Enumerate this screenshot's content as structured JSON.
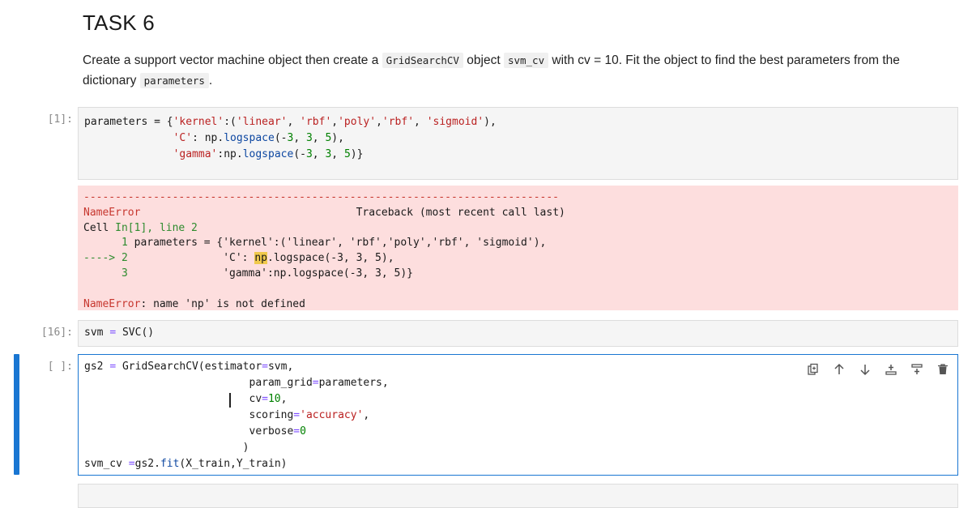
{
  "markdown": {
    "title": "TASK 6",
    "p1_a": "Create a support vector machine object then create a",
    "code1": "GridSearchCV",
    "p1_b": "object",
    "code2": "svm_cv",
    "p1_c": "with cv = 10. Fit the object to find the best parameters from the",
    "p2_a": "dictionary",
    "code3": "parameters",
    "p2_b": "."
  },
  "cells": [
    {
      "prompt": "[1]:"
    },
    {
      "prompt": "[16]:"
    },
    {
      "prompt": "[ ]:"
    }
  ],
  "cell1": {
    "l1_a": "parameters = {",
    "l1_s1": "'kernel'",
    "l1_b": ":(",
    "l1_s2": "'linear'",
    "l1_c": ", ",
    "l1_s3": "'rbf'",
    "l1_d": ",",
    "l1_s4": "'poly'",
    "l1_e": ",",
    "l1_s5": "'rbf'",
    "l1_f": ", ",
    "l1_s6": "'sigmoid'",
    "l1_g": "),",
    "l2_pad": "              ",
    "l2_s": "'C'",
    "l2_a": ": np.",
    "l2_fn": "logspace",
    "l2_b": "(-",
    "l2_n1": "3",
    "l2_c": ", ",
    "l2_n2": "3",
    "l2_d": ", ",
    "l2_n3": "5",
    "l2_e": "),",
    "l3_pad": "              ",
    "l3_s": "'gamma'",
    "l3_a": ":np.",
    "l3_fn": "logspace",
    "l3_b": "(-",
    "l3_n1": "3",
    "l3_c": ", ",
    "l3_n2": "3",
    "l3_d": ", ",
    "l3_n3": "5",
    "l3_e": ")}"
  },
  "error": {
    "dashes": "---------------------------------------------------------------------------",
    "name": "NameError",
    "tb_pad": "                                  ",
    "tb": "Traceback (most recent call last)",
    "cell_pre": "Cell ",
    "cell_in": "In[1], line 2",
    "ln1_pad": "      ",
    "ln1_num": "1",
    "ln1_text": " parameters = {'kernel':('linear', 'rbf','poly','rbf', 'sigmoid'),",
    "ln2_arrow": "----> 2",
    "ln2_pad": "               ",
    "ln2_a": "'C': ",
    "ln2_hl": "np",
    "ln2_b": ".logspace(-3, 3, 5),",
    "ln3_pad": "      ",
    "ln3_num": "3",
    "ln3_text": "               'gamma':np.logspace(-3, 3, 5)}",
    "last_name": "NameError",
    "last_msg": ": name 'np' is not defined"
  },
  "cell2": {
    "a": "svm ",
    "op": "=",
    "b": " SVC()"
  },
  "cell3": {
    "l1_a": "gs2 ",
    "l1_op": "=",
    "l1_b": " GridSearchCV(estimator",
    "l1_op2": "=",
    "l1_c": "svm,",
    "l2_pad": "                          ",
    "l2_a": "param_grid",
    "l2_op": "=",
    "l2_b": "parameters,",
    "l3_pad": "                          ",
    "l3_a": "cv",
    "l3_op": "=",
    "l3_n": "10",
    "l3_b": ",",
    "l4_pad": "                          ",
    "l4_a": "scoring",
    "l4_op": "=",
    "l4_s": "'accuracy'",
    "l4_b": ",",
    "l5_pad": "                          ",
    "l5_a": "verbose",
    "l5_op": "=",
    "l5_n": "0",
    "l6_pad": "                         ",
    "l6_a": ")",
    "l7_a": "svm_cv ",
    "l7_op": "=",
    "l7_b": "gs2.",
    "l7_fn": "fit",
    "l7_c": "(X_train,Y_train)"
  },
  "toolbar": {
    "icons": [
      "duplicate-icon",
      "move-up-icon",
      "move-down-icon",
      "insert-above-icon",
      "insert-below-icon",
      "delete-icon"
    ]
  },
  "colors": {
    "accent": "#1976d2",
    "error_bg": "#fddede",
    "string": "#ba2121",
    "number": "#008000"
  }
}
